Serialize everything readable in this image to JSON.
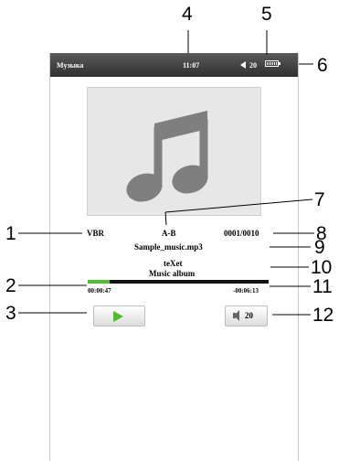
{
  "status_bar": {
    "title": "Музыка",
    "time": "11:07",
    "volume": "20",
    "battery_icon": "battery-icon",
    "speaker_icon": "speaker-icon"
  },
  "player": {
    "cover_icon": "music-note-icon",
    "bitrate_mode": "VBR",
    "repeat_mode": "A-B",
    "track_counter": "0001/0010",
    "filename": "Sample_music.mp3",
    "artist": "teXet",
    "album": "Music album",
    "elapsed": "00:00:47",
    "remaining": "-00:06:13",
    "progress_fraction": 0.12,
    "volume_button": "20"
  },
  "accent_color": "#4cbf2a",
  "callouts": [
    "1",
    "2",
    "3",
    "4",
    "5",
    "6",
    "7",
    "8",
    "9",
    "10",
    "11",
    "12"
  ]
}
